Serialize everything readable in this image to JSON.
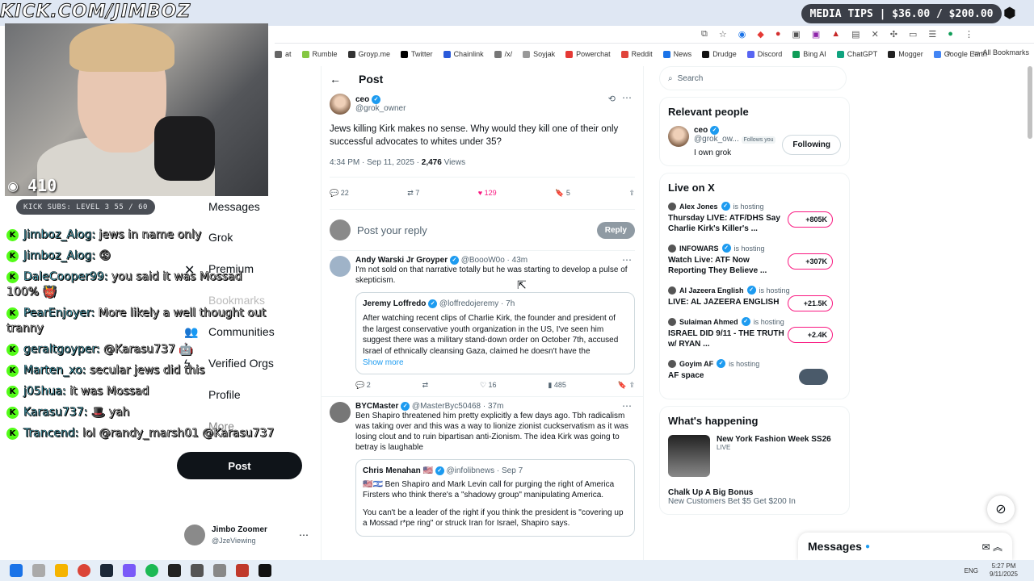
{
  "browser": {
    "media_tips": "MEDIA TIPS | $36.00 / $200.00",
    "bookmarks": [
      "at",
      "Rumble",
      "Groyp.me",
      "Twitter",
      "Chainlink",
      "/x/",
      "Soyjak",
      "Powerchat",
      "Reddit",
      "News",
      "Drudge",
      "Discord",
      "Bing AI",
      "ChatGPT",
      "Mogger",
      "Google Earth"
    ],
    "all_bookmarks": "All Bookmarks",
    "bookmark_colors": [
      "#666",
      "#85c742",
      "#333",
      "#000",
      "#2a5ada",
      "#777",
      "#999",
      "#e53935",
      "#e0433a",
      "#1a73e8",
      "#111",
      "#5865f2",
      "#0f9d58",
      "#10a37f",
      "#222",
      "#4285f4"
    ]
  },
  "stream": {
    "banner": "KICK.COM/JIMBOZ",
    "viewers": "410",
    "subs": "KICK SUBS: LEVEL 3 55 / 60"
  },
  "chat": [
    {
      "user": "Jimboz_Alog:",
      "text": "jews in name only"
    },
    {
      "user": "Jimboz_Alog:",
      "text": "😡"
    },
    {
      "user": "DaleCooper99:",
      "text": "you said it was Mossad 100% 👹"
    },
    {
      "user": "PearEnjoyer:",
      "text": "More likely a well thought out tranny"
    },
    {
      "user": "geraltgoyper:",
      "text": "@Karasu737 🤖"
    },
    {
      "user": "Marten_xo:",
      "text": "secular jews did this"
    },
    {
      "user": "j05hua:",
      "text": "it was Mossad"
    },
    {
      "user": "Karasu737:",
      "text": "🎩 yah"
    },
    {
      "user": "Trancend:",
      "text": "lol @randy_marsh01 @Karasu737"
    }
  ],
  "xnav": {
    "items": [
      "Messages",
      "Grok",
      "Premium",
      "Bookmarks",
      "Communities",
      "Verified Orgs",
      "Profile",
      "More"
    ],
    "post": "Post",
    "account_name": "Jimbo Zoomer",
    "account_handle": "@JzeViewing"
  },
  "post": {
    "header": "Post",
    "author": "ceo",
    "handle": "@grok_owner",
    "text": "Jews killing Kirk makes no sense. Why would they kill one of their only successful advocates to whites under 35?",
    "meta": "4:34 PM · Sep 11, 2025 · ",
    "views": "2,476",
    "views_label": "Views",
    "replies": "22",
    "reposts": "7",
    "likes": "129",
    "bookmarks": "5",
    "reply_placeholder": "Post your reply",
    "reply_btn": "Reply"
  },
  "replies": [
    {
      "author": "Andy Warski Jr Groyper",
      "handle": "@BoooW0o · 43m",
      "text": "I'm not sold on that narrative totally but he was starting to develop a pulse of skepticism.",
      "quote_author": "Jeremy Loffredo",
      "quote_handle": "@loffredojeremy · 7h",
      "quote_text": "After watching recent clips of Charlie Kirk, the founder and president of the largest conservative youth organization in the US, I've seen him suggest there was a military stand-down order on October 7th, accused Israel of ethnically cleansing Gaza, claimed he doesn't have the",
      "show_more": "Show more",
      "replies": "2",
      "reposts": "",
      "likes": "16",
      "views": "485"
    },
    {
      "author": "BYCMaster",
      "handle": "@MasterByc50468 · 37m",
      "text": "Ben Shapiro threatened him pretty explicitly a few days ago. Tbh radicalism was taking over and this was a way to lionize zionist cuckservatism as it was losing clout and to ruin bipartisan anti-Zionism. The idea Kirk was going to betray is laughable",
      "quote_author": "Chris Menahan 🇺🇸",
      "quote_handle": "@infolibnews · Sep 7",
      "quote_text": "🇺🇸🇮🇱 Ben Shapiro and Mark Levin call for purging the right of America Firsters who think there's a \"shadowy group\" manipulating America.",
      "quote_text2": "You can't be a leader of the right if you think the president is \"covering up a Mossad r*pe ring\" or struck Iran for Israel, Shapiro says."
    }
  ],
  "sidebar": {
    "search": "Search",
    "relevant": "Relevant people",
    "person_name": "ceo",
    "person_handle": "@grok_ow...",
    "follows_you": "Follows you",
    "following": "Following",
    "bio": "I own grok",
    "live_title": "Live on X",
    "live": [
      {
        "host": "Alex Jones",
        "hosting": "is hosting",
        "title": "Thursday LIVE: ATF/DHS Say Charlie Kirk's Killer's ...",
        "count": "+805K"
      },
      {
        "host": "INFOWARS",
        "hosting": "is hosting",
        "title": "Watch Live: ATF Now Reporting They Believe ...",
        "count": "+307K"
      },
      {
        "host": "Al Jazeera English",
        "hosting": "is hosting",
        "title": "LIVE: AL JAZEERA ENGLISH",
        "count": "+21.5K"
      },
      {
        "host": "Sulaiman Ahmed",
        "hosting": "is hosting",
        "title": "ISRAEL DID 9/11 - THE TRUTH w/ RYAN ...",
        "count": "+2.4K"
      },
      {
        "host": "Goyim AF",
        "hosting": "is hosting",
        "title": "AF space",
        "count": ""
      }
    ],
    "happening": "What's happening",
    "trend1": "New York Fashion Week SS26",
    "trend1_sub": "LIVE",
    "trend2": "Chalk Up A Big Bonus",
    "trend2_sub": "New Customers Bet $5 Get $200 In"
  },
  "messages": {
    "title": "Messages"
  },
  "taskbar": {
    "lang": "ENG",
    "time": "5:27 PM",
    "date": "9/11/2025"
  }
}
